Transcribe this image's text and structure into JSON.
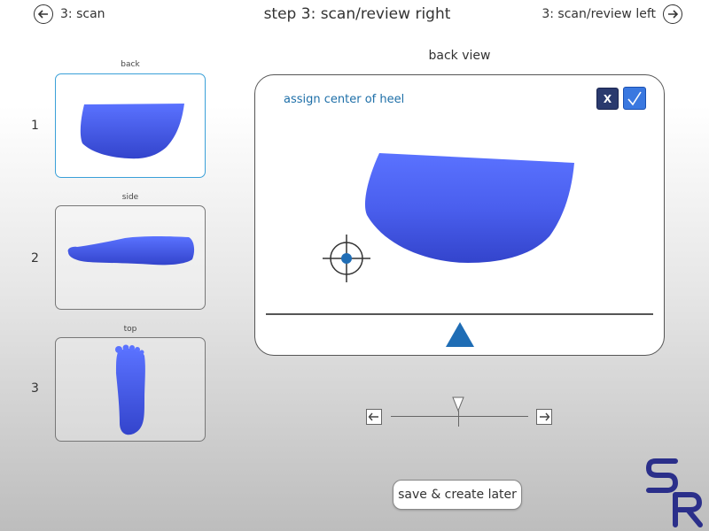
{
  "header": {
    "back_label": "3: scan",
    "title": "step 3: scan/review right",
    "forward_label": "3: scan/review left"
  },
  "thumbnails": [
    {
      "number": "1",
      "label": "back",
      "selected": true
    },
    {
      "number": "2",
      "label": "side",
      "selected": false
    },
    {
      "number": "3",
      "label": "top",
      "selected": false
    }
  ],
  "main_view": {
    "title": "back view",
    "prompt": "assign center of heel",
    "cancel_label": "X"
  },
  "colors": {
    "accent": "#3aa0d8",
    "foot_blue": "#4a62f0",
    "marker_blue": "#1f6db5",
    "prompt_text": "#1e6fa8"
  },
  "slider": {
    "position": 0.5
  },
  "actions": {
    "save_label": "save & create later"
  },
  "logo": {
    "text": "SR"
  }
}
